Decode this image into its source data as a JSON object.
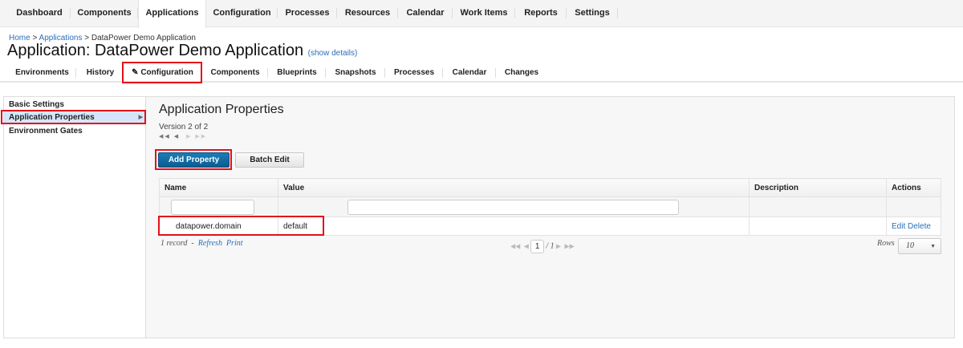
{
  "top_nav": [
    "Dashboard",
    "Components",
    "Applications",
    "Configuration",
    "Processes",
    "Resources",
    "Calendar",
    "Work Items",
    "Reports",
    "Settings"
  ],
  "active_top_tab": "Applications",
  "breadcrumb": {
    "home": "Home",
    "applications": "Applications",
    "sep": ">",
    "current": "DataPower Demo Application"
  },
  "page_title": "Application: DataPower Demo Application",
  "show_details": "(show details)",
  "sub_nav": [
    "Environments",
    "History",
    "Configuration",
    "Components",
    "Blueprints",
    "Snapshots",
    "Processes",
    "Calendar",
    "Changes"
  ],
  "active_sub_tab": "Configuration",
  "sidebar": [
    "Basic Settings",
    "Application Properties",
    "Environment Gates"
  ],
  "selected_sidebar": "Application Properties",
  "main": {
    "heading": "Application Properties",
    "version": "Version 2 of 2",
    "add_property": "Add Property",
    "batch_edit": "Batch Edit",
    "columns": [
      "Name",
      "Value",
      "Description",
      "Actions"
    ],
    "rows": [
      {
        "name": "datapower.domain",
        "value": "default",
        "description": "",
        "actions": [
          "Edit",
          "Delete"
        ]
      }
    ],
    "record_count": "1 record",
    "refresh": "Refresh",
    "print": "Print",
    "page": "1",
    "page_total": "/ 1",
    "rows_label": "Rows",
    "rows_value": "10"
  },
  "colors": {
    "highlight": "#e3101a",
    "primary": "#0b5c8f",
    "link": "#2a6ebb"
  }
}
